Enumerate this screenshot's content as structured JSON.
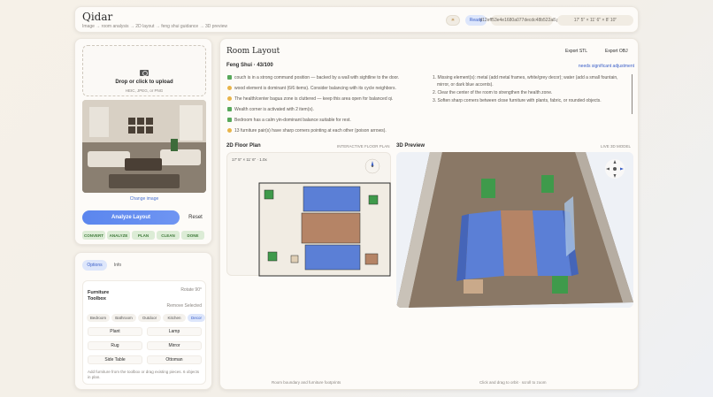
{
  "header": {
    "title": "Qidar",
    "breadcrumb": "Image → room analysis → 2D layout → feng shui guidance → 3D preview",
    "status": "Ready",
    "filename": "d12eff53e4e1680a077decdc48b522a8.png",
    "dimensions": "17' 5\" × 11' 6\" × 8' 10\""
  },
  "upload": {
    "title": "Drop or click to upload",
    "subtitle": "HEIC, JPEG, or PNG",
    "change_label": "Change image"
  },
  "actions": {
    "analyze": "Analyze Layout",
    "reset": "Reset"
  },
  "pipeline_steps": [
    "CONVERT",
    "ANALYZE",
    "PLAN",
    "CLEAN",
    "DONE"
  ],
  "toolbox": {
    "tabs": [
      "Options",
      "Info"
    ],
    "title": "Furniture Toolbox",
    "rotate": "Rotate 90°",
    "remove": "Remove Selected",
    "categories": [
      "Bedroom",
      "Bathroom",
      "Outdoor",
      "Kitchen",
      "Decor"
    ],
    "active_category": "Decor",
    "items": [
      "Plant",
      "Lamp",
      "Rug",
      "Mirror",
      "Side Table",
      "Ottoman"
    ],
    "hint": "Add furniture from the toolbox or drag existing pieces. 6 objects in plan."
  },
  "main": {
    "title": "Room Layout",
    "export_stl": "Export STL",
    "export_obj": "Export OBJ",
    "score": "Feng Shui · 43/100",
    "adjust_note": "needs significant adjustment",
    "observations": [
      {
        "icon": "check",
        "text": "couch is in a strong command position — backed by a wall with sightline to the door."
      },
      {
        "icon": "warn",
        "text": "wood element is dominant (6/6 items). Consider balancing with its cycle neighbors."
      },
      {
        "icon": "warn",
        "text": "The health/center bagua zone is cluttered — keep this area open for balanced qi."
      },
      {
        "icon": "check",
        "text": "Wealth corner is activated with 2 item(s)."
      },
      {
        "icon": "check",
        "text": "Bedroom has a calm yin-dominant balance suitable for rest."
      },
      {
        "icon": "warn",
        "text": "13 furniture pair(s) have sharp corners pointing at each other (poison arrows)."
      }
    ],
    "recommendations": [
      "1. Missing element(s): metal (add metal frames, white/grey decor); water (add a small fountain,",
      "    mirror, or dark blue accents).",
      "2. Clear the center of the room to strengthen the health zone.",
      "3. Soften sharp corners between close furniture with plants, fabric, or rounded objects."
    ],
    "floor_plan": {
      "title": "2D Floor Plan",
      "subtitle": "INTERACTIVE FLOOR PLAN",
      "dims": "17' 5\" × 11' 6\" · 1.0x",
      "footer": "Room boundary and furniture footprints"
    },
    "preview": {
      "title": "3D Preview",
      "subtitle": "LIVE 3D MODEL",
      "footer": "Click and drag to orbit · scroll to zoom"
    }
  },
  "colors": {
    "accent": "#5b86ee",
    "sofa": "#5b7fd6",
    "table": "#b58466",
    "plant": "#3f9a4b",
    "step_done": "#dcecd6"
  }
}
